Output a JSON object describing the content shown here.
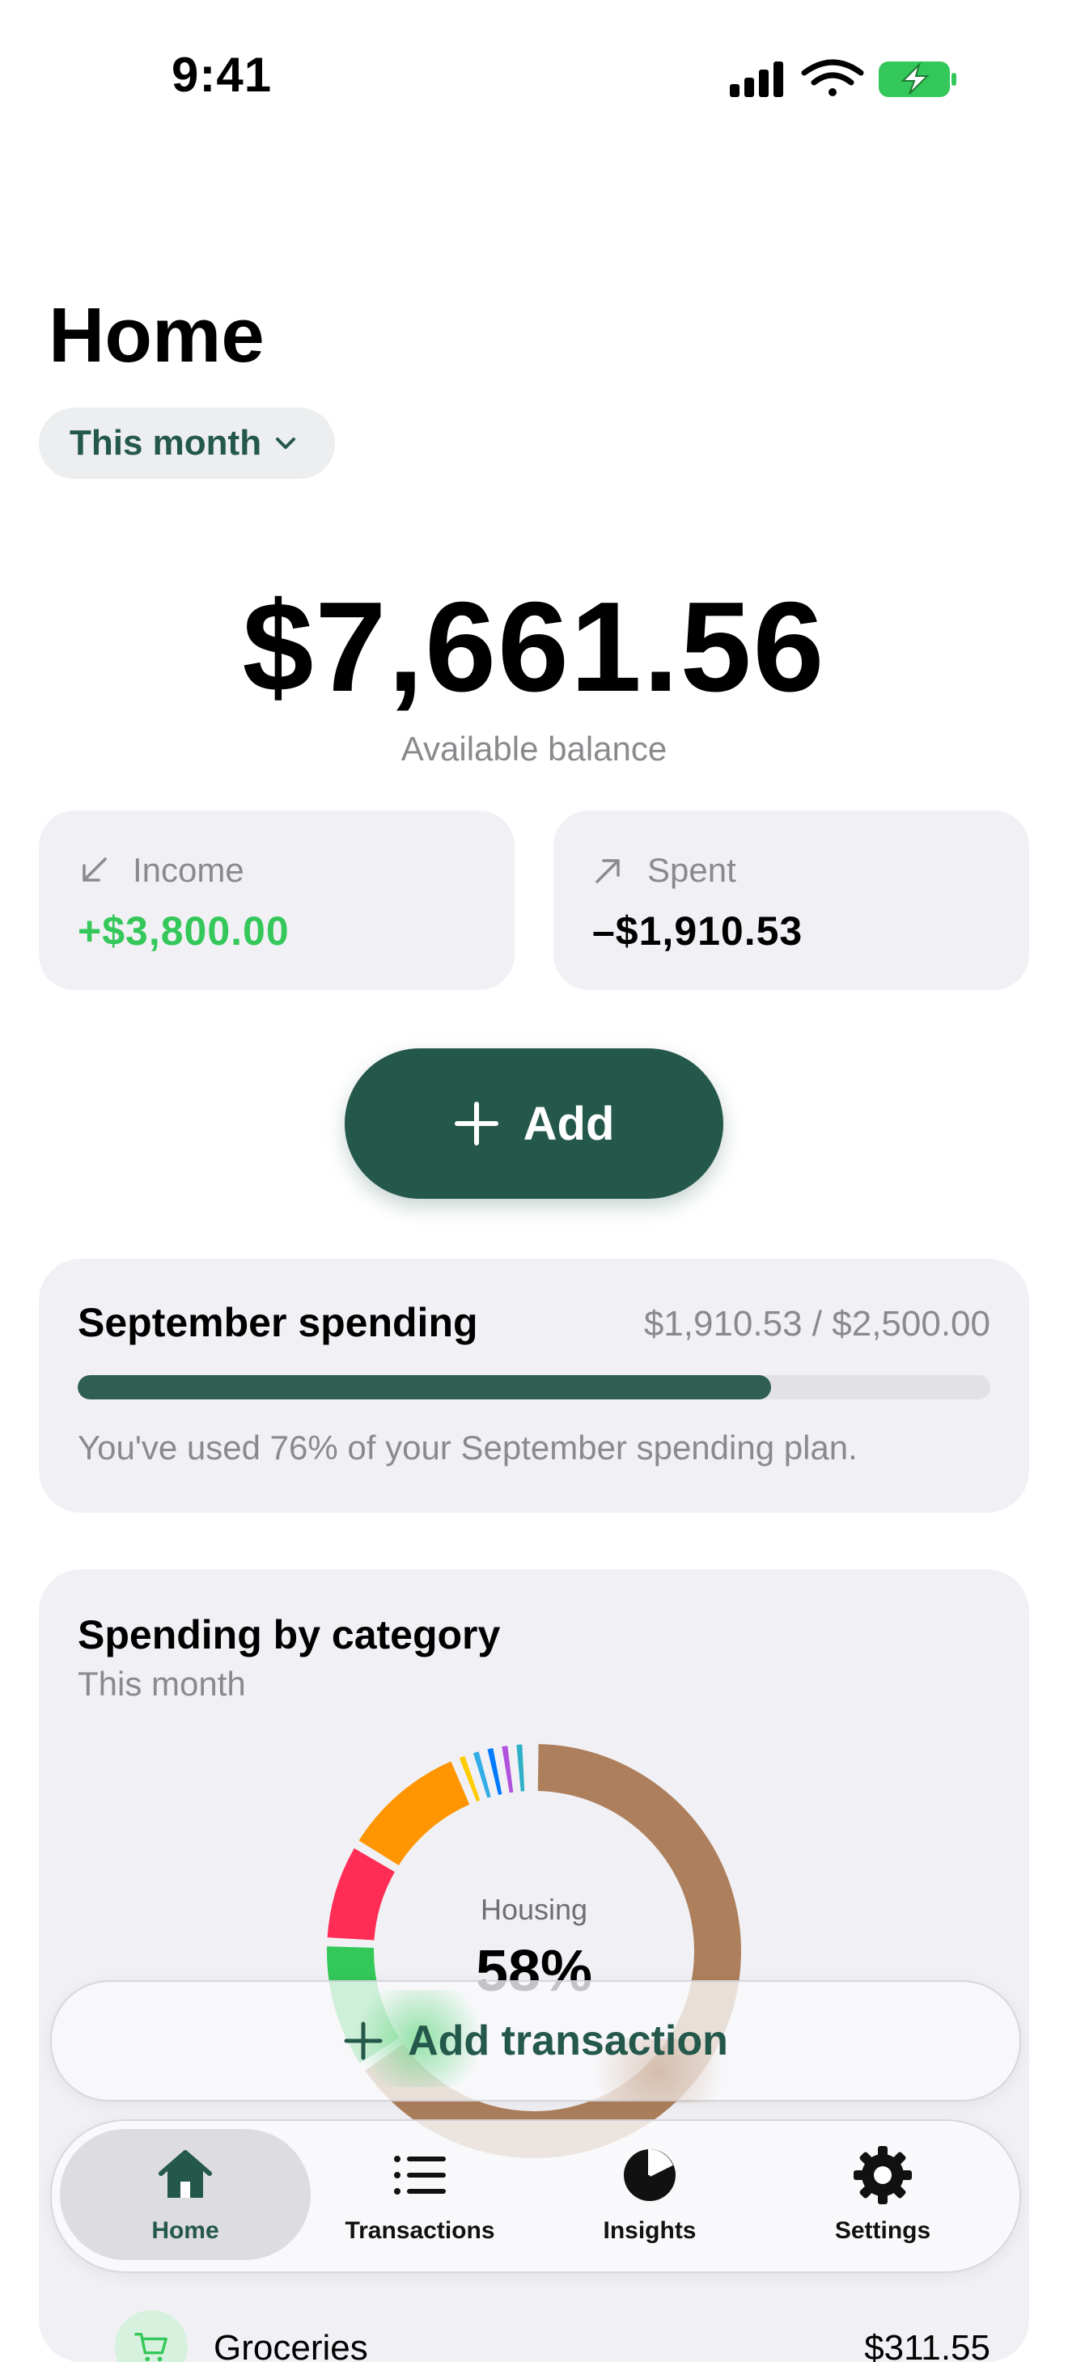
{
  "status": {
    "time": "9:41"
  },
  "page": {
    "title": "Home"
  },
  "range": {
    "label": "This month"
  },
  "balance": {
    "amount": "$7,661.56",
    "label": "Available balance"
  },
  "income": {
    "label": "Income",
    "value": "+$3,800.00"
  },
  "spent": {
    "label": "Spent",
    "value": "–$1,910.53"
  },
  "add_button": {
    "label": "Add"
  },
  "budget": {
    "title": "September spending",
    "amount": "$1,910.53 / $2,500.00",
    "progress": 0.76,
    "note": "You've used 76% of your September spending plan."
  },
  "categories": {
    "title": "Spending by category",
    "subtitle": "This month",
    "center_label": "Housing",
    "center_value": "58%",
    "chart_data": {
      "type": "pie",
      "values": [
        58,
        9,
        7,
        9,
        1,
        1,
        1,
        1,
        1,
        0.5
      ],
      "colors": [
        "#ad7f5c",
        "#34c759",
        "#ff2d55",
        "#ff9500",
        "#ffcc00",
        "#32ade6",
        "#007aff",
        "#af52de",
        "#30b0c7",
        "#ff3b30"
      ]
    },
    "first_row": {
      "name": "Groceries",
      "amount": "$311.55",
      "icon": "cart-icon"
    }
  },
  "add_transaction": {
    "label": "Add transaction"
  },
  "tabs": [
    {
      "label": "Home",
      "icon": "house-icon"
    },
    {
      "label": "Transactions",
      "icon": "list-icon"
    },
    {
      "label": "Insights",
      "icon": "pie-chart-icon"
    },
    {
      "label": "Settings",
      "icon": "gear-icon"
    }
  ],
  "colors": {
    "accent": "#24584a",
    "income": "#34c759",
    "card": "#f1f1f5"
  }
}
